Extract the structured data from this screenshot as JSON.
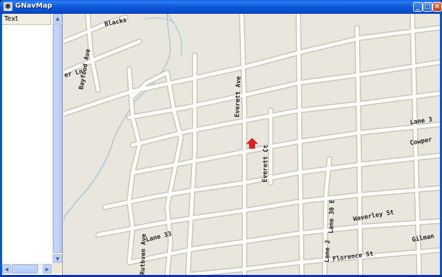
{
  "window": {
    "title": "GNavMap"
  },
  "titlebar_buttons": {
    "minimize": "_",
    "maximize": "□",
    "close": "×"
  },
  "panel": {
    "header": "Text"
  },
  "map": {
    "labels": {
      "blackstone": "Blacks",
      "bayfood": "Bayfood Ave",
      "lane_w": "er Ln",
      "everett_ave": "Everett Ave",
      "everett_ct": "Everett Ct",
      "lane_3": "Lane 3",
      "cowper": "Cowper",
      "lane_30e": "Lane 30 E",
      "lane_2": "Lane 2",
      "waverley": "Waverley St",
      "ruthven": "Ruthven Ave",
      "lane_33": "Lane 33",
      "florence": "Florence St",
      "gilman": "Gilman"
    },
    "marker_icon": "location-arrow-icon",
    "colors": {
      "land": "#e9e6dd",
      "road": "#ffffff",
      "road_edge": "#c9c4b4",
      "water": "#9cc3d9",
      "marker": "#e32020"
    }
  }
}
